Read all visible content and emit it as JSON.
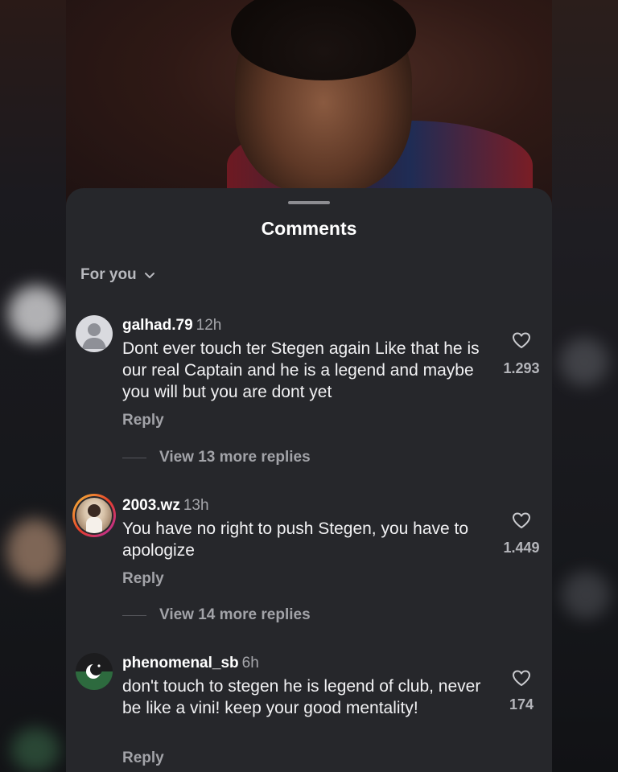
{
  "sheet": {
    "title": "Comments",
    "filter_label": "For you"
  },
  "comments": [
    {
      "username": "galhad.79",
      "time": "12h",
      "text": "Dont ever touch ter Stegen again Like that he is our real Captain and he is a legend and maybe you will but you are dont yet",
      "likes": "1.293",
      "reply_label": "Reply",
      "view_more": "View 13 more replies"
    },
    {
      "username": "2003.wz",
      "time": "13h",
      "text": "You have no right to push Stegen, you have to apologize",
      "likes": "1.449",
      "reply_label": "Reply",
      "view_more": "View 14 more replies"
    },
    {
      "username": "phenomenal_sb",
      "time": "6h",
      "text": "don't touch to stegen he is legend of club, never be like a vini! keep your good mentality!",
      "likes": "174",
      "reply_label": "Reply"
    }
  ],
  "icons": {
    "filter_chevron": "chevron-down-icon",
    "like": "heart-icon",
    "default_avatar": "person-icon",
    "flag_avatar": "crescent-star-icon"
  },
  "colors": {
    "sheet_bg": "#26272b",
    "text_primary": "#f1f1f3",
    "text_secondary": "#a2a3a8"
  }
}
